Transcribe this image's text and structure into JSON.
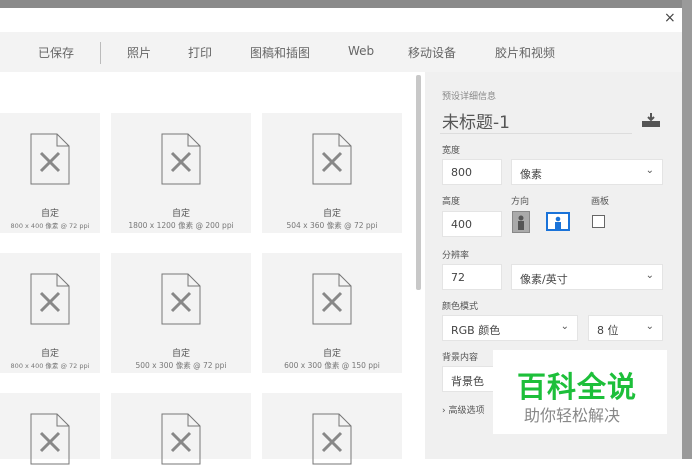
{
  "tabs": [
    "已保存",
    "照片",
    "打印",
    "图稿和插图",
    "Web",
    "移动设备",
    "胶片和视频"
  ],
  "presets": [
    {
      "name": "自定",
      "size": "800 x 400 像素 @ 72 ppi"
    },
    {
      "name": "自定",
      "size": "1800 x 1200 像素 @ 200 ppi"
    },
    {
      "name": "自定",
      "size": "504 x 360 像素 @ 72 ppi"
    },
    {
      "name": "自定",
      "size": "800 x 400 像素 @ 72 ppi"
    },
    {
      "name": "自定",
      "size": "500 x 300 像素 @ 72 ppi"
    },
    {
      "name": "自定",
      "size": "600 x 300 像素 @ 150 ppi"
    }
  ],
  "details": {
    "heading": "预设详细信息",
    "doc_title": "未标题-1",
    "width_label": "宽度",
    "width": "800",
    "width_unit": "像素",
    "height_label": "高度",
    "height": "400",
    "orientation_label": "方向",
    "artboard_label": "画板",
    "resolution_label": "分辨率",
    "resolution": "72",
    "resolution_unit": "像素/英寸",
    "color_mode_label": "颜色模式",
    "color_mode": "RGB 颜色",
    "bit_depth": "8 位",
    "bg_label": "背景内容",
    "bg": "背景色",
    "advanced": "高级选项"
  },
  "watermark": {
    "line1": "百科全说",
    "line2": "助你轻松解决"
  },
  "close": "×"
}
